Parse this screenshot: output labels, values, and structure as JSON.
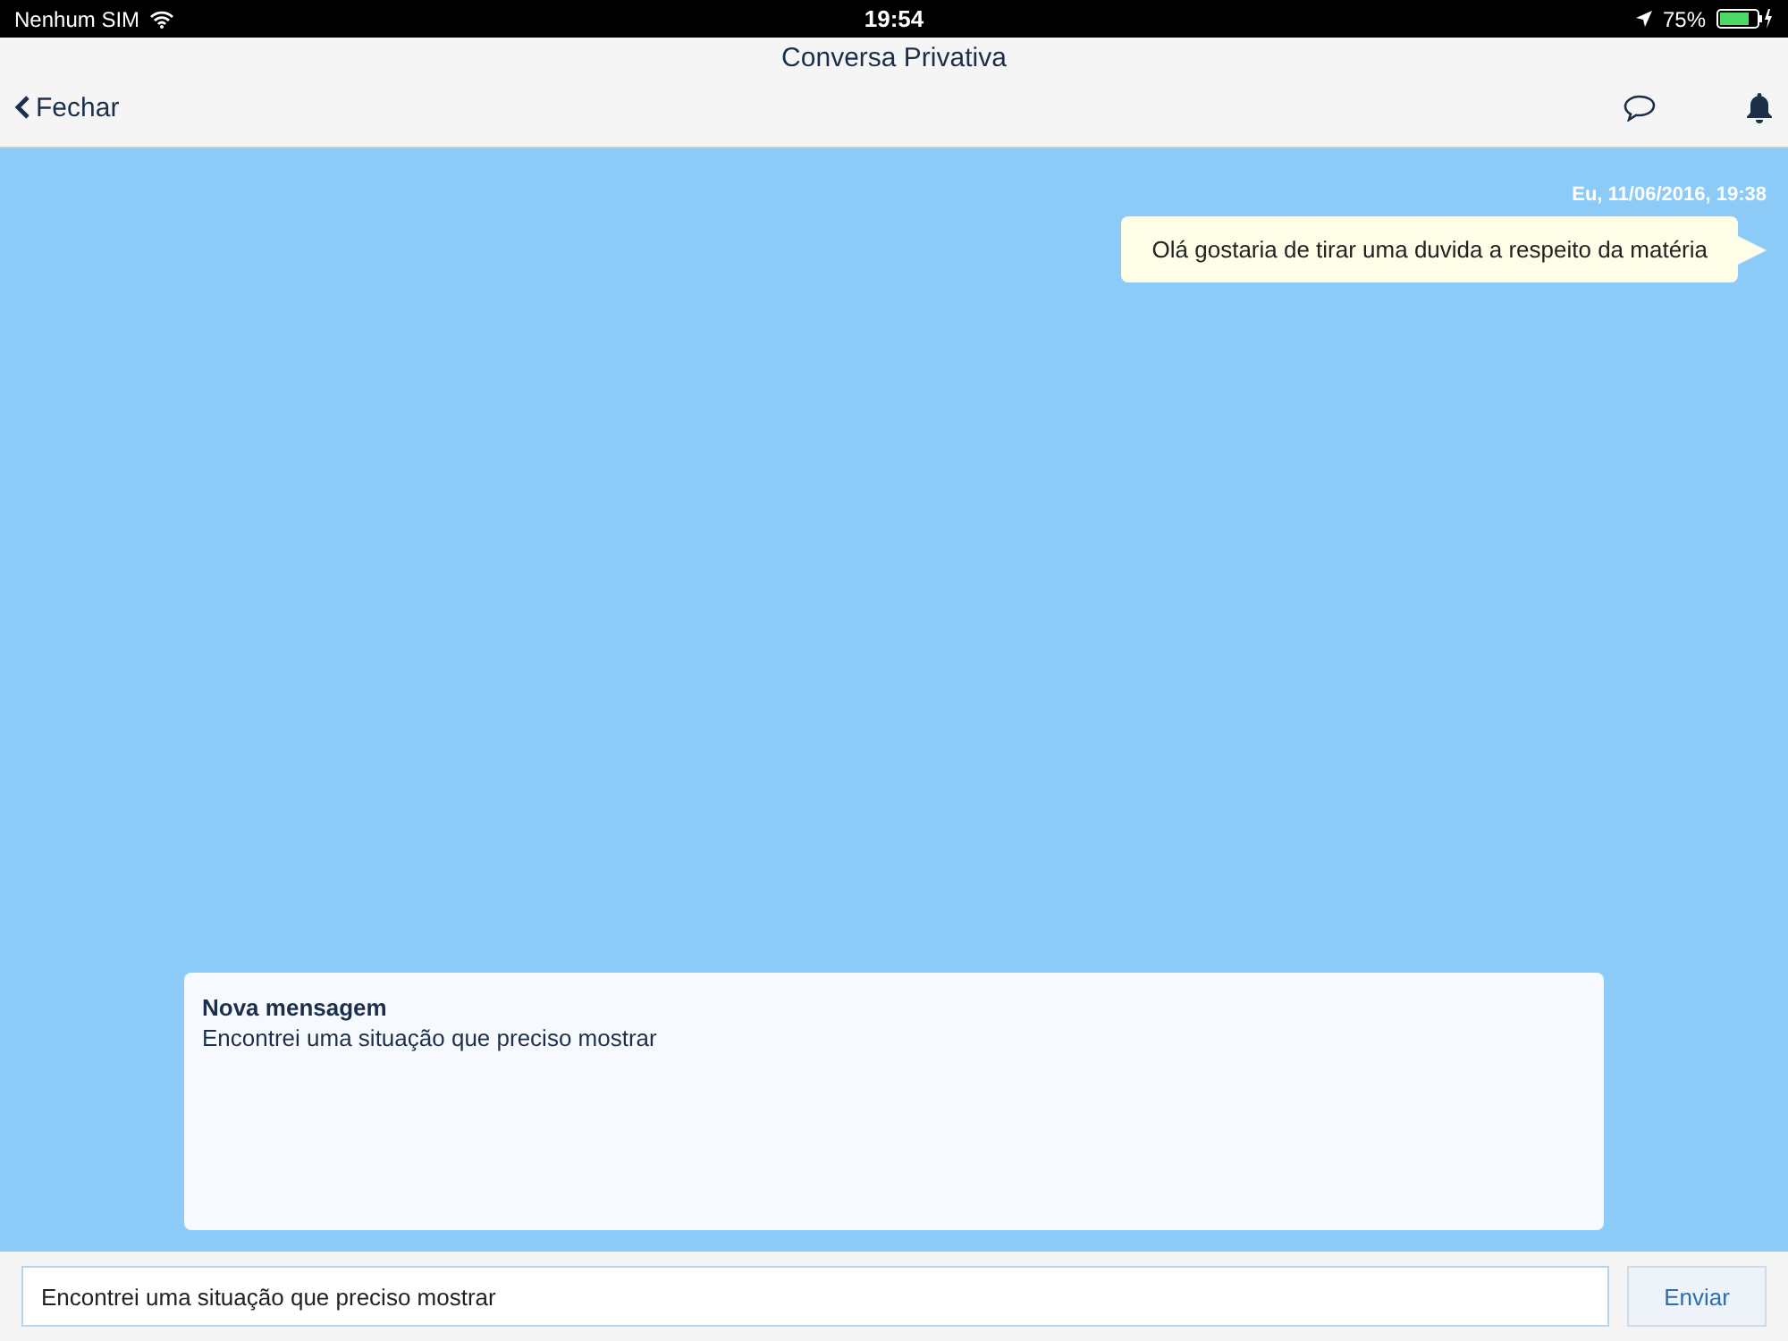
{
  "status_bar": {
    "carrier": "Nenhum SIM",
    "time": "19:54",
    "battery": "75%"
  },
  "header": {
    "title": "Conversa Privativa",
    "back": "Fechar"
  },
  "messages": [
    {
      "meta": "Eu, 11/06/2016, 19:38",
      "text": "Olá gostaria de tirar uma duvida a respeito da matéria",
      "outgoing": true
    }
  ],
  "preview": {
    "title": "Nova mensagem",
    "text": "Encontrei uma situação que preciso mostrar"
  },
  "composer": {
    "value": "Encontrei uma situação que preciso mostrar",
    "send": "Enviar"
  }
}
